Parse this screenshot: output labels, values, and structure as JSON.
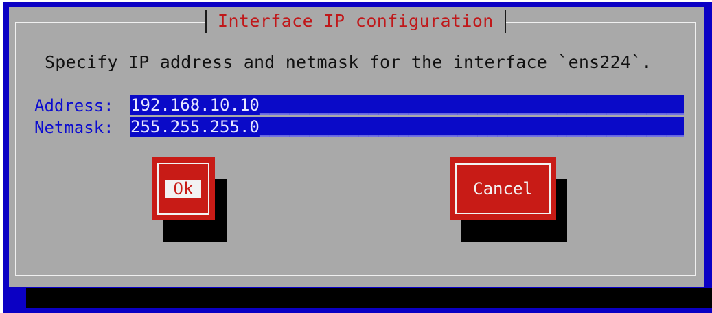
{
  "dialog": {
    "title": "Interface IP configuration",
    "prompt": "Specify IP address and netmask for the interface `ens224`."
  },
  "fields": {
    "address": {
      "label": "Address:",
      "value": "192.168.10.10"
    },
    "netmask": {
      "label": "Netmask:",
      "value": "255.255.255.0"
    }
  },
  "buttons": {
    "ok_label": "Ok",
    "cancel_label": "Cancel"
  },
  "colors": {
    "background": "#0b00c4",
    "dialog": "#a9a9a9",
    "accent": "#c81b16",
    "input": "#0a0ac8"
  }
}
